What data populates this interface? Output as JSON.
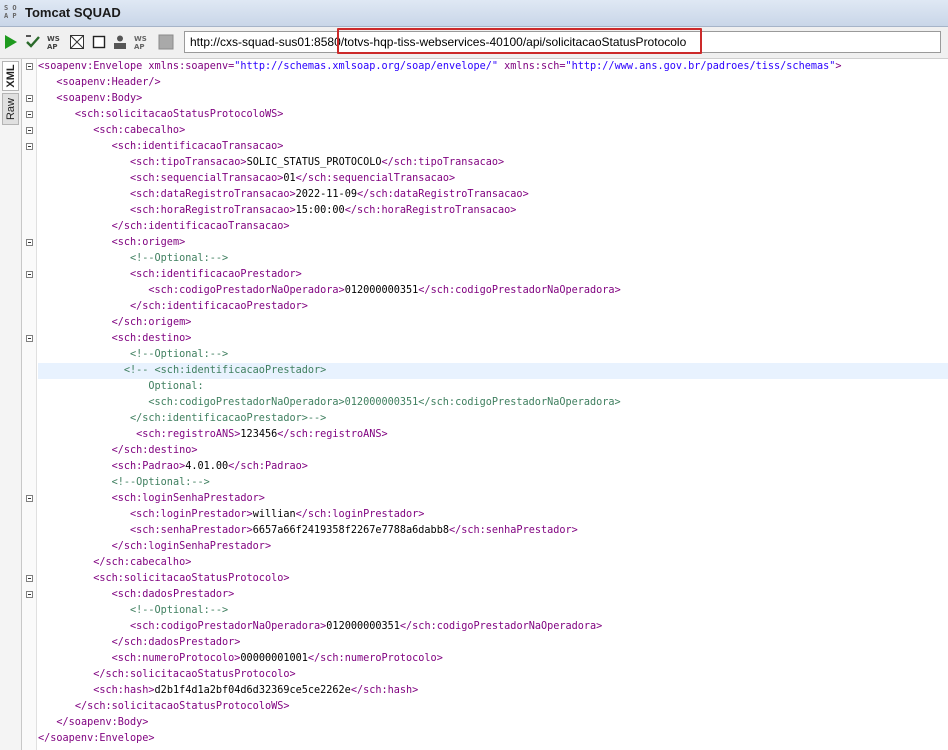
{
  "window": {
    "title": "Tomcat SQUAD",
    "logo_text": "SOAP"
  },
  "toolbar": {
    "url": "http://cxs-squad-sus01:8580/totvs-hqp-tiss-webservices-40100/api/solicitacaoStatusProtocolo",
    "buttons": [
      "run-icon",
      "validate-icon",
      "format-icon",
      "grid-icon",
      "stop-icon",
      "user-icon",
      "soap-icon",
      "wsa-icon",
      "square-icon"
    ]
  },
  "side_tabs": {
    "xml": "XML",
    "raw": "Raw"
  },
  "xml_lines": [
    "<soapenv:Envelope xmlns:soapenv=\"http://schemas.xmlsoap.org/soap/envelope/\" xmlns:sch=\"http://www.ans.gov.br/padroes/tiss/schemas\">",
    "   <soapenv:Header/>",
    "   <soapenv:Body>",
    "      <sch:solicitacaoStatusProtocoloWS>",
    "         <sch:cabecalho>",
    "            <sch:identificacaoTransacao>",
    "               <sch:tipoTransacao>SOLIC_STATUS_PROTOCOLO</sch:tipoTransacao>",
    "               <sch:sequencialTransacao>01</sch:sequencialTransacao>",
    "               <sch:dataRegistroTransacao>2022-11-09</sch:dataRegistroTransacao>",
    "               <sch:horaRegistroTransacao>15:00:00</sch:horaRegistroTransacao>",
    "            </sch:identificacaoTransacao>",
    "            <sch:origem>",
    "               <!--Optional:-->",
    "               <sch:identificacaoPrestador>",
    "                  <sch:codigoPrestadorNaOperadora>012000000351</sch:codigoPrestadorNaOperadora>",
    "               </sch:identificacaoPrestador>",
    "            </sch:origem>",
    "            <sch:destino>",
    "               <!--Optional:-->",
    "              <!-- <sch:identificacaoPrestador>",
    "                  Optional:",
    "                  <sch:codigoPrestadorNaOperadora>012000000351</sch:codigoPrestadorNaOperadora>",
    "               </sch:identificacaoPrestador>-->",
    "                <sch:registroANS>123456</sch:registroANS>",
    "            </sch:destino>",
    "            <sch:Padrao>4.01.00</sch:Padrao>",
    "            <!--Optional:-->",
    "            <sch:loginSenhaPrestador>",
    "               <sch:loginPrestador>willian</sch:loginPrestador>",
    "               <sch:senhaPrestador>6657a66f2419358f2267e7788a6dabb8</sch:senhaPrestador>",
    "            </sch:loginSenhaPrestador>",
    "         </sch:cabecalho>",
    "         <sch:solicitacaoStatusProtocolo>",
    "            <sch:dadosPrestador>",
    "               <!--Optional:-->",
    "               <sch:codigoPrestadorNaOperadora>012000000351</sch:codigoPrestadorNaOperadora>",
    "            </sch:dadosPrestador>",
    "            <sch:numeroProtocolo>00000001001</sch:numeroProtocolo>",
    "         </sch:solicitacaoStatusProtocolo>",
    "         <sch:hash>d2b1f4d1a2bf04d6d32369ce5ce2262e</sch:hash>",
    "      </sch:solicitacaoStatusProtocoloWS>",
    "   </soapenv:Body>",
    "</soapenv:Envelope>"
  ]
}
